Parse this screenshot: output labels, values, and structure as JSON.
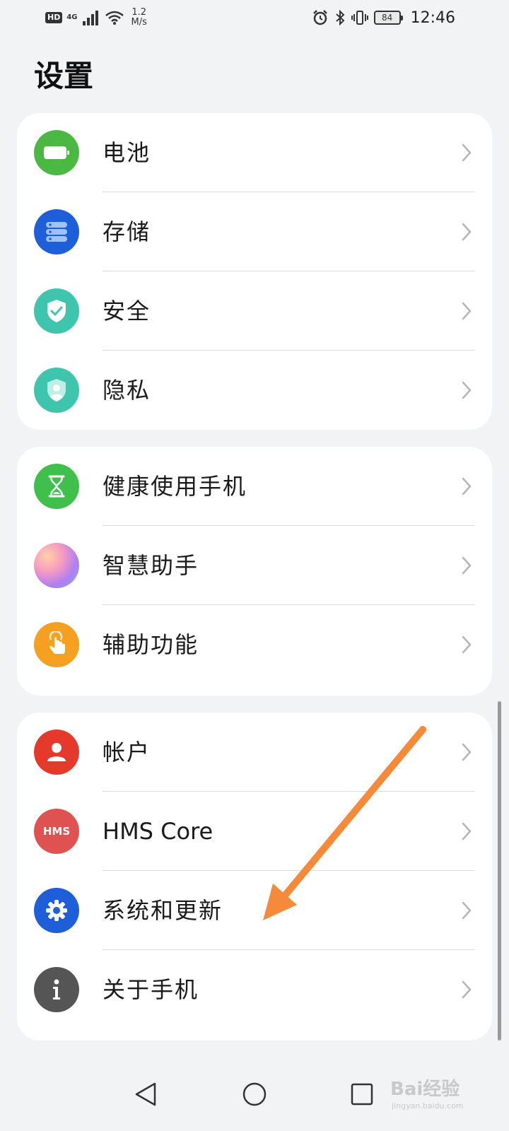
{
  "status_bar": {
    "hd": "HD",
    "network": "4G",
    "speed_value": "1.2",
    "speed_unit": "M/s",
    "battery": "84",
    "time": "12:46",
    "icons": [
      "alarm-icon",
      "bluetooth-icon",
      "vibrate-icon"
    ]
  },
  "page": {
    "title": "设置"
  },
  "cards": [
    {
      "items": [
        {
          "label": "电池",
          "icon": "battery-icon",
          "color": "#4cb844"
        },
        {
          "label": "存储",
          "icon": "storage-icon",
          "color": "#1f5ed9"
        },
        {
          "label": "安全",
          "icon": "shield-check-icon",
          "color": "#3fc5ad"
        },
        {
          "label": "隐私",
          "icon": "privacy-shield-icon",
          "color": "#3fc5ad"
        }
      ]
    },
    {
      "items": [
        {
          "label": "健康使用手机",
          "icon": "hourglass-icon",
          "color": "#3fc04c"
        },
        {
          "label": "智慧助手",
          "icon": "assistant-orb-icon",
          "color": "#b07ff0"
        },
        {
          "label": "辅助功能",
          "icon": "hand-touch-icon",
          "color": "#f5a020"
        }
      ]
    },
    {
      "items": [
        {
          "label": "帐户",
          "icon": "person-icon",
          "color": "#e53a2b"
        },
        {
          "label": "HMS Core",
          "icon": "hms-logo-icon",
          "color": "#e05252",
          "logo_text": "HMS"
        },
        {
          "label": "系统和更新",
          "icon": "gear-icon",
          "color": "#1f5ed9"
        },
        {
          "label": "关于手机",
          "icon": "info-icon",
          "color": "#555555"
        }
      ]
    }
  ],
  "nav": {
    "icons": [
      "back-triangle-icon",
      "home-circle-icon",
      "recents-square-icon"
    ]
  },
  "watermark": {
    "main": "Bai经验",
    "sub": "jingyan.baidu.com"
  },
  "annotation": {
    "arrow_color": "#f58a3a"
  }
}
